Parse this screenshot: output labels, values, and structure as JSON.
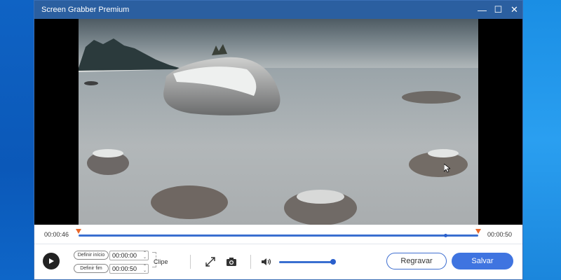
{
  "window": {
    "title": "Screen Grabber Premium",
    "controls": {
      "minimize": "—",
      "maximize": "☐",
      "close": "✕"
    }
  },
  "timeline": {
    "current_time": "00:00:46",
    "end_time": "00:00:50"
  },
  "controls": {
    "set_start_label": "Definir início",
    "start_value": "00:00:00",
    "set_end_label": "Definir fim",
    "end_value": "00:00:50",
    "clip_label": "Clipe",
    "rerecord_label": "Regravar",
    "save_label": "Salvar"
  },
  "colors": {
    "accent": "#3f74e0",
    "marker": "#e8672a",
    "titlebar": "#2b5fa0"
  },
  "icons": [
    "play-icon",
    "expand-icon",
    "camera-icon",
    "volume-icon"
  ]
}
